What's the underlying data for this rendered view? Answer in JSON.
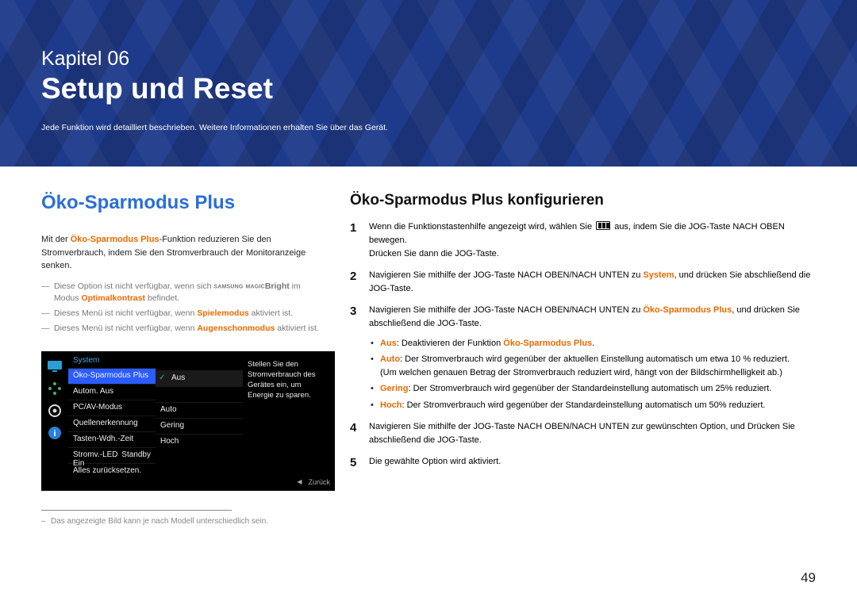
{
  "page_number": "49",
  "header": {
    "chapter_label": "Kapitel 06",
    "chapter_title": "Setup und Reset",
    "subtitle": "Jede Funktion wird detailliert beschrieben. Weitere Informationen erhalten Sie über das Gerät."
  },
  "left": {
    "heading": "Öko-Sparmodus Plus",
    "intro_pre": "Mit der ",
    "intro_feature": "Öko-Sparmodus Plus",
    "intro_post": "-Funktion reduzieren Sie den Stromverbrauch, indem Sie den Stromverbrauch der Monitoranzeige senken.",
    "notes": [
      {
        "pre": "Diese Option ist nicht verfügbar, wenn sich ",
        "magic_pre": "SAMSUNG",
        "magic": "MAGIC",
        "bold1": "Bright",
        "mid": " im Modus ",
        "orange": "Optimalkontrast",
        "post": " befindet."
      },
      {
        "pre": "Dieses Menü ist nicht verfügbar, wenn ",
        "orange": "Spielemodus",
        "post": " aktiviert ist."
      },
      {
        "pre": "Dieses Menü ist nicht verfügbar, wenn ",
        "orange": "Augenschonmodus",
        "post": " aktiviert ist."
      }
    ],
    "footnote": "Das angezeigte Bild kann je nach Modell unterschiedlich sein."
  },
  "osd": {
    "title": "System",
    "col1": [
      "Öko-Sparmodus Plus",
      "Autom. Aus",
      "PC/AV-Modus",
      "Quellenerkennung",
      "Tasten-Wdh.-Zeit",
      "Stromv.-LED Ein",
      "Alles zurücksetzen."
    ],
    "col2": [
      "Aus",
      "",
      "Auto",
      "Gering",
      "Hoch",
      "",
      ""
    ],
    "col1_extra_val": "Standby",
    "desc": "Stellen Sie den Stromverbrauch des Gerätes ein, um Energie zu sparen.",
    "back": "Zurück"
  },
  "right": {
    "heading": "Öko-Sparmodus Plus konfigurieren",
    "steps": [
      {
        "pre": "Wenn die Funktionstastenhilfe angezeigt wird, wählen Sie ",
        "post_icon": " aus, indem Sie die JOG-Taste NACH OBEN bewegen.",
        "line2": "Drücken Sie dann die JOG-Taste."
      },
      {
        "pre": "Navigieren Sie mithilfe der JOG-Taste NACH OBEN/NACH UNTEN zu ",
        "orange": "System",
        "post": ", und drücken Sie abschließend die JOG-Taste."
      },
      {
        "pre": "Navigieren Sie mithilfe der JOG-Taste NACH OBEN/NACH UNTEN zu ",
        "orange": "Öko-Sparmodus Plus",
        "post": ", und drücken Sie abschließend die JOG-Taste."
      },
      {
        "text": "Navigieren Sie mithilfe der JOG-Taste NACH OBEN/NACH UNTEN zur gewünschten Option, und Drücken Sie abschließend die JOG-Taste."
      },
      {
        "text": "Die gewählte Option wird aktiviert."
      }
    ],
    "options": [
      {
        "name": "Aus",
        "desc_pre": ": Deaktivieren der Funktion ",
        "desc_orange": "Öko-Sparmodus Plus",
        "desc_post": "."
      },
      {
        "name": "Auto",
        "desc": ": Der Stromverbrauch wird gegenüber der aktuellen Einstellung automatisch um etwa 10 % reduziert.",
        "sub": "(Um welchen genauen Betrag der Stromverbrauch reduziert wird, hängt von der Bildschirmhelligkeit ab.)"
      },
      {
        "name": "Gering",
        "desc": ": Der Stromverbrauch wird gegenüber der Standardeinstellung automatisch um 25% reduziert."
      },
      {
        "name": "Hoch",
        "desc": ": Der Stromverbrauch wird gegenüber der Standardeinstellung automatisch um 50% reduziert."
      }
    ]
  }
}
